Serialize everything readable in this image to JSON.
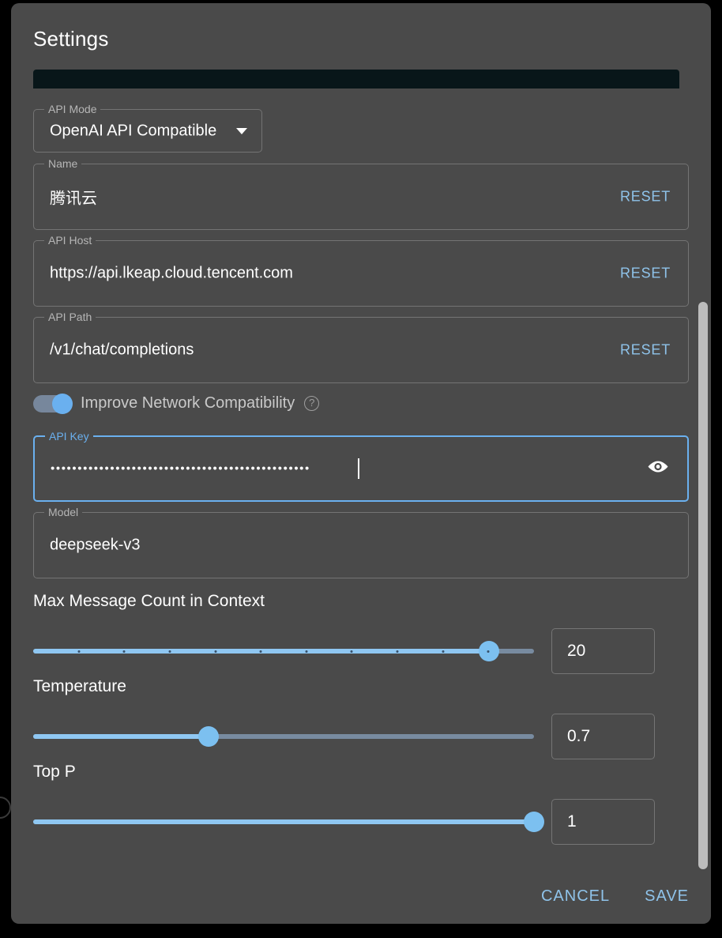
{
  "dialog": {
    "title": "Settings"
  },
  "fields": {
    "api_mode": {
      "label": "API Mode",
      "value": "OpenAI API Compatible",
      "icon": "chevron-down-icon"
    },
    "name": {
      "label": "Name",
      "value": "腾讯云",
      "reset_label": "RESET"
    },
    "api_host": {
      "label": "API Host",
      "value": "https://api.lkeap.cloud.tencent.com",
      "reset_label": "RESET"
    },
    "api_path": {
      "label": "API Path",
      "value": "/v1/chat/completions",
      "reset_label": "RESET"
    },
    "api_key": {
      "label": "API Key",
      "value": "••••••••••••••••••••••••••••••••••••••••••••••••",
      "focused": true,
      "reveal_icon": "eye-icon"
    },
    "model": {
      "label": "Model",
      "value": "deepseek-v3"
    }
  },
  "toggle": {
    "label": "Improve Network Compatibility",
    "state": "on",
    "help_icon": "help-circle-icon"
  },
  "sliders": [
    {
      "title": "Max Message Count in Context",
      "value": "20",
      "percent": 91,
      "ticks": 10
    },
    {
      "title": "Temperature",
      "value": "0.7",
      "percent": 35,
      "ticks": 0
    },
    {
      "title": "Top P",
      "value": "1",
      "percent": 100,
      "ticks": 0
    }
  ],
  "footer": {
    "cancel_label": "CANCEL",
    "save_label": "SAVE"
  },
  "colors": {
    "accent": "#8fc3ea",
    "slider_fill": "#8fc7f2",
    "dialog_bg": "#4a4a4a",
    "page_bg": "#000000",
    "focus_border": "#6ab0ef"
  }
}
